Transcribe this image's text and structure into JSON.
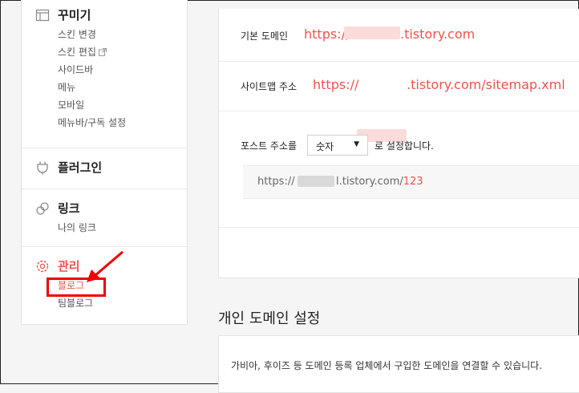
{
  "sidebar": {
    "decorate": {
      "title": "꾸미기",
      "items": [
        "스킨 변경",
        "스킨 편집",
        "사이드바",
        "메뉴",
        "모바일",
        "메뉴바/구독 설정"
      ]
    },
    "plugin": {
      "title": "플러그인"
    },
    "link": {
      "title": "링크",
      "items": [
        "나의 링크"
      ]
    },
    "manage": {
      "title": "관리",
      "items": [
        "블로그",
        "팀블로그"
      ]
    }
  },
  "main": {
    "default_domain": {
      "label": "기본 도메인",
      "url_prefix": "https://",
      "url_suffix": ".tistory.com"
    },
    "sitemap": {
      "label": "사이트맵 주소",
      "url_prefix": "https://",
      "url_suffix": ".tistory.com/sitemap.xml"
    },
    "post_address": {
      "label": "포스트 주소를",
      "select_value": "숫자",
      "suffix": "로 설정합니다.",
      "preview_prefix": "https://",
      "preview_mid": "l.tistory.com/",
      "preview_number": "123"
    },
    "personal_domain": {
      "heading": "개인 도메인 설정",
      "description": "가비아, 후이즈 등 도메인 등록 업체에서 구입한 도메인을 연결할 수 있습니다."
    }
  },
  "colors": {
    "accent": "#f0524b",
    "highlight": "#e00000"
  },
  "icons": [
    "layout-icon",
    "external-link-icon",
    "plug-icon",
    "link-icon",
    "gear-icon",
    "red-arrow-annotation"
  ]
}
